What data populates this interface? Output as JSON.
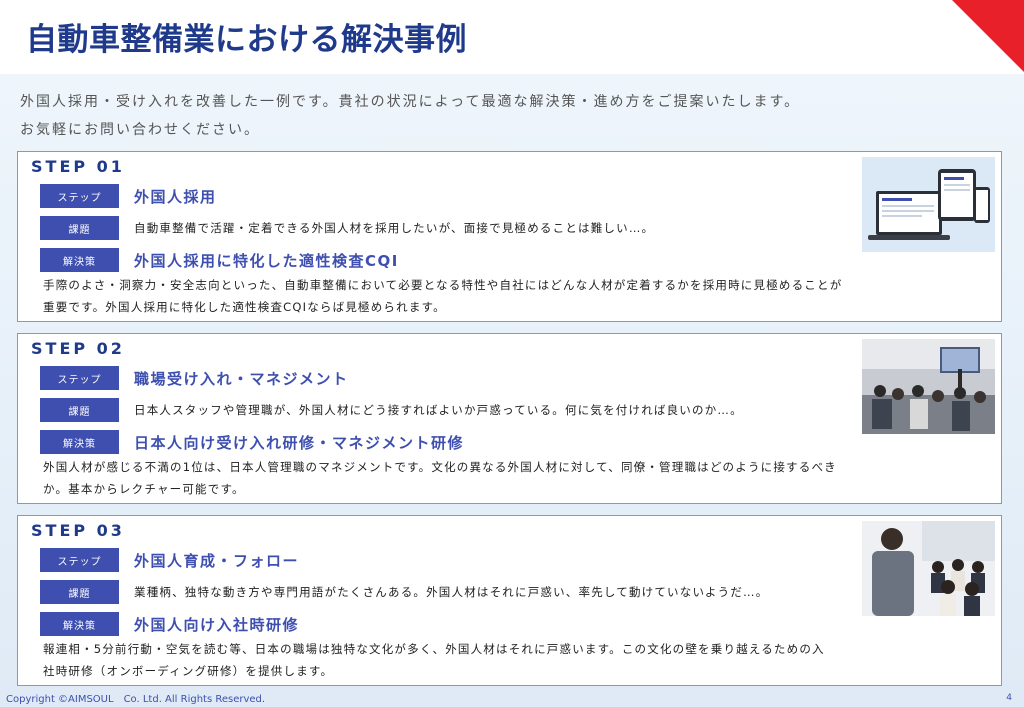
{
  "title": "自動車整備業における解決事例",
  "intro": {
    "line1": "外国人採用・受け入れを改善した一例です。貴社の状況によって最適な解決策・進め方をご提案いたします。",
    "line2": "お気軽にお問い合わせください。"
  },
  "tags": {
    "step": "ステップ",
    "issue": "課題",
    "solution": "解決策"
  },
  "steps": [
    {
      "label": "STEP 01",
      "step_title": "外国人採用",
      "issue": "自動車整備で活躍・定着できる外国人材を採用したいが、面接で見極めることは難しい…。",
      "solution": "外国人採用に特化した適性検査CQI",
      "desc_line1": "手際のよさ・洞察力・安全志向といった、自動車整備において必要となる特性や自社にはどんな人材が定着するかを採用時に見極めることが",
      "desc_line2": "重要です。外国人採用に特化した適性検査CQIならば見極められます。",
      "image": "laptop-and-phones-screen-image"
    },
    {
      "label": "STEP 02",
      "step_title": "職場受け入れ・マネジメント",
      "issue": "日本人スタッフや管理職が、外国人材にどう接すればよいか戸惑っている。何に気を付ければ良いのか…。",
      "solution": "日本人向け受け入れ研修・マネジメント研修",
      "desc_line1": "外国人材が感じる不満の1位は、日本人管理職のマネジメントです。文化の異なる外国人材に対して、同僚・管理職はどのように接するべき",
      "desc_line2": "か。基本からレクチャー可能です。",
      "image": "seminar-room-photo"
    },
    {
      "label": "STEP 03",
      "step_title": "外国人育成・フォロー",
      "issue": "業種柄、独特な動き方や専門用語がたくさんある。外国人材はそれに戸惑い、率先して動けていないようだ…。",
      "solution": "外国人向け入社時研修",
      "desc_line1": "報連相・5分前行動・空気を読む等、日本の職場は独特な文化が多く、外国人材はそれに戸惑います。この文化の壁を乗り越えるための入",
      "desc_line2": "社時研修（オンボーディング研修）を提供します。",
      "image": "training-class-photo"
    }
  ],
  "footer": "Copyright ©AIMSOUL　Co. Ltd. All Rights Reserved.",
  "page_number": "4",
  "colors": {
    "title": "#1f3a8a",
    "tag_bg": "#3e4fb0",
    "accent_red": "#e8202a"
  }
}
